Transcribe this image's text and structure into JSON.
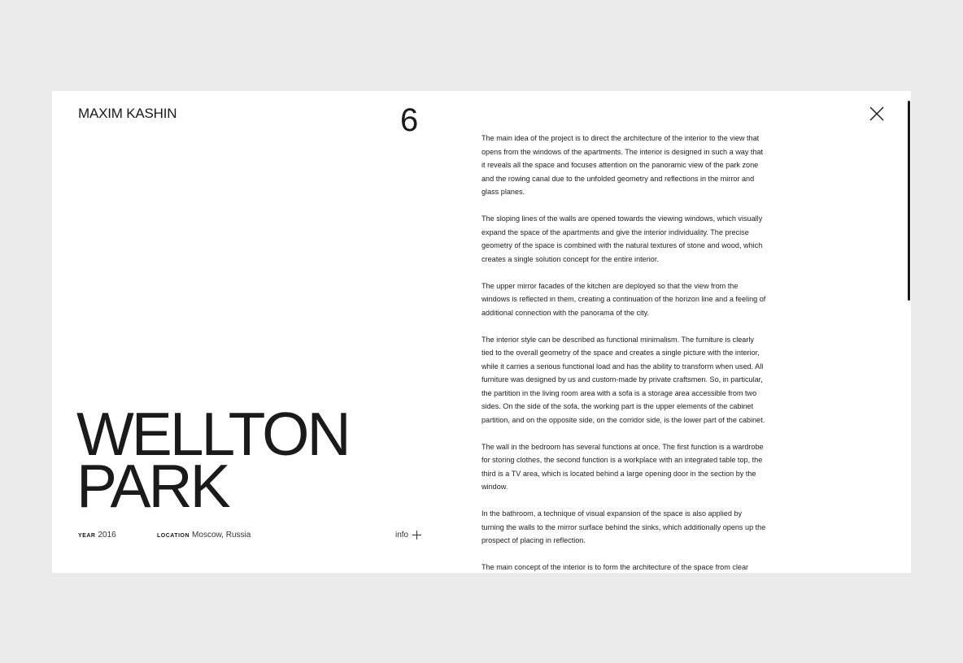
{
  "header": {
    "brand": "MAXIM KASHIN",
    "counter": "6",
    "close_icon": "close-icon"
  },
  "project": {
    "title_line1": "WELLTON",
    "title_line2": "PARK",
    "year_label": "YEAR",
    "year_value": "2016",
    "location_label": "LOCATION",
    "location_value": "Moscow, Russia",
    "info_label": "info",
    "info_icon": "plus-icon"
  },
  "description": {
    "paragraphs": [
      "The main idea of the project is to direct the architecture of the interior to the view that opens from the windows of the apartments. The interior is designed in such a way that it reveals all the space and focuses attention on the panoramic view of the park zone and the rowing canal due to the unfolded geometry and reflections in the mirror and glass planes.",
      "The sloping lines of the walls are opened towards the viewing windows, which visually expand the space of the apartments and give the interior individuality. The precise geometry of the space is combined with the natural textures of stone and wood, which creates a single solution concept for the entire interior.",
      "The upper mirror facades of the kitchen are deployed so that the view from the windows is reflected in them, creating a continuation of the horizon line and a feeling of additional connection with the panorama of the city.",
      "The interior style can be described as functional minimalism. The furniture is clearly tied to the overall geometry of the space and creates a single picture with the interior, while it carries a serious functional load and has the ability to transform when used. All furniture was designed by us and custom-made by private craftsmen. So, in particular, the partition in the living room area with a sofa is a storage area accessible from two sides. On the side of the sofa, the working part is the upper elements of the cabinet partition, and on the opposite side, on the corridor side, is the lower part of the cabinet.",
      "The wall in the bedroom has several functions at once. The first function is a wardrobe for storing clothes, the second function is a workplace with an integrated table top, the third is a TV area, which is located behind a large opening door in the section by the window.",
      "In the bathroom, a technique of visual expansion of the space is also applied by turning the walls to the mirror surface behind the sinks, which additionally opens up the prospect of placing in reflection.",
      "The main concept of the interior is to form the architecture of the space from clear geometric forms, which are, in turn, the functional core of the apartments. Therefore, our"
    ]
  },
  "colors": {
    "background": "#ebebeb",
    "panel": "#ffffff",
    "text": "#1a1a1a"
  }
}
